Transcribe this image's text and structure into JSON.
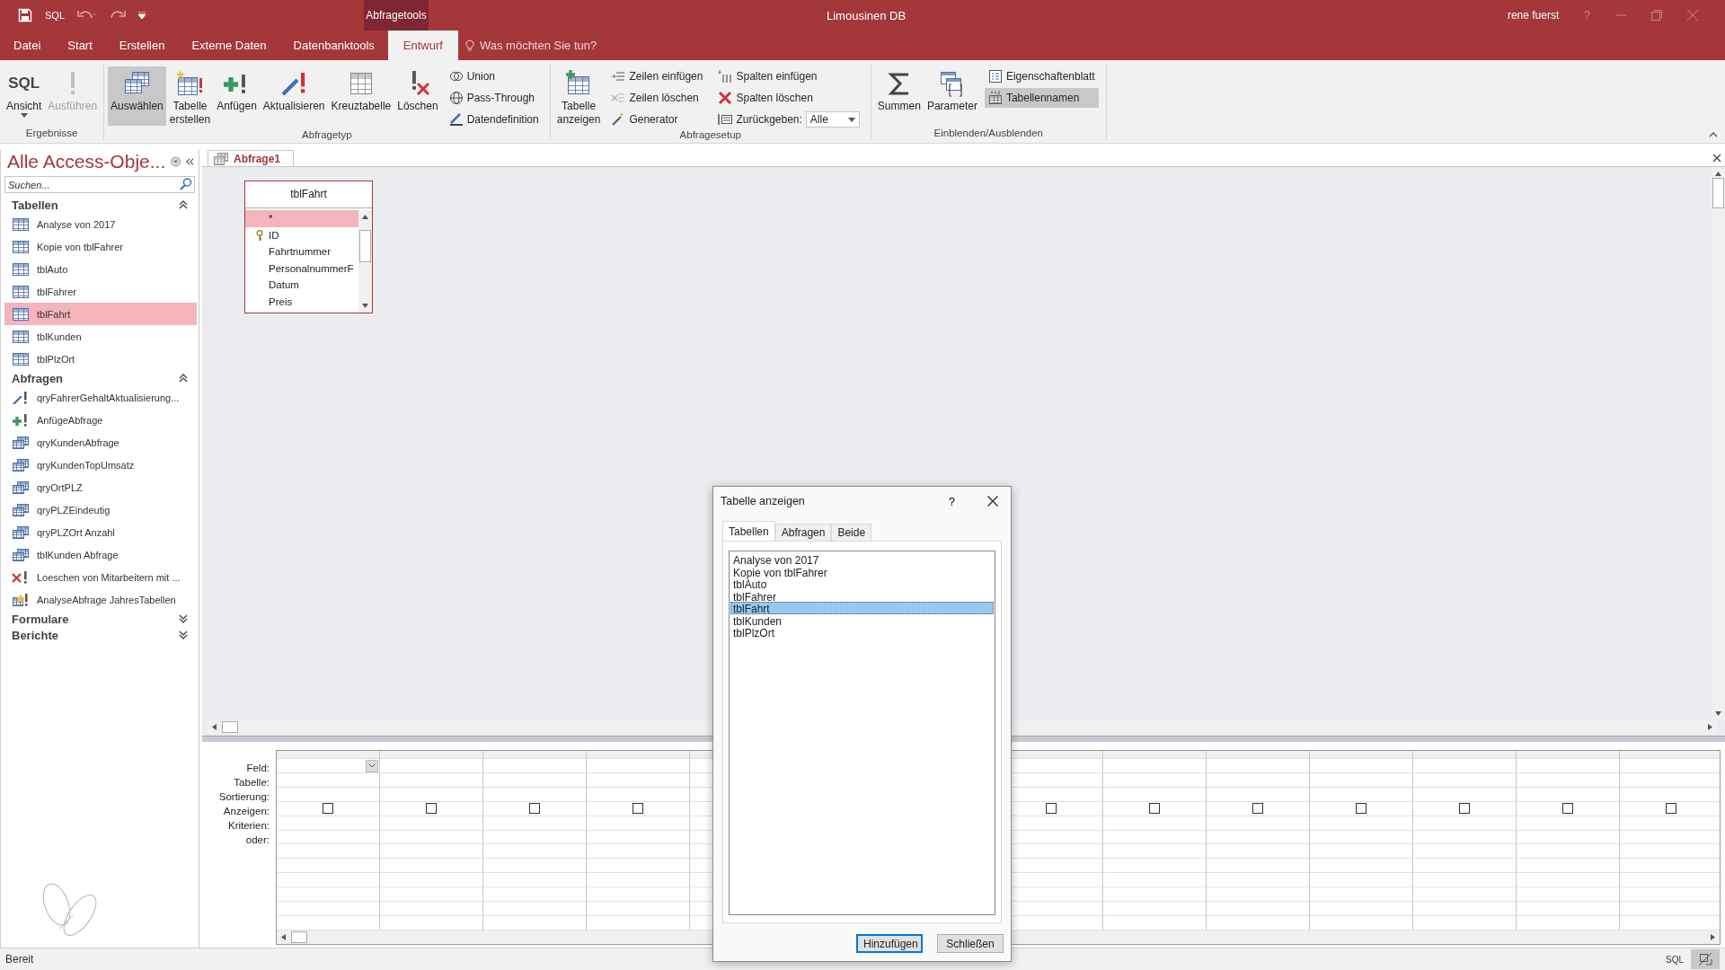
{
  "title_bar": {
    "quick_access_label": "SQL",
    "context_label": "Abfragetools",
    "title": "Limousinen DB",
    "user": "rene fuerst",
    "help": "?"
  },
  "menu_tabs": [
    {
      "label": "Datei",
      "selected": false
    },
    {
      "label": "Start",
      "selected": false
    },
    {
      "label": "Erstellen",
      "selected": false
    },
    {
      "label": "Externe Daten",
      "selected": false
    },
    {
      "label": "Datenbanktools",
      "selected": false
    },
    {
      "label": "Entwurf",
      "selected": true
    }
  ],
  "tell_me": {
    "placeholder": "Was möchten Sie tun?"
  },
  "ribbon": {
    "groups": [
      {
        "label": "Ergebnisse",
        "items": [
          {
            "kind": "large",
            "icon_text": "SQL",
            "label": "Ansicht",
            "dropdown": true,
            "selected": false,
            "disabled": false
          },
          {
            "kind": "large",
            "label": "Ausführen",
            "dropdown": false,
            "selected": false,
            "disabled": true
          }
        ]
      },
      {
        "label": "Abfragetyp",
        "items": [
          {
            "kind": "large",
            "label": "Auswählen",
            "dropdown": false,
            "selected": true,
            "disabled": false
          },
          {
            "kind": "large",
            "label": "Tabelle erstellen",
            "dropdown": false,
            "selected": false,
            "disabled": false
          },
          {
            "kind": "large",
            "label": "Anfügen",
            "dropdown": false,
            "selected": false,
            "disabled": false
          },
          {
            "kind": "large",
            "label": "Aktualisieren",
            "dropdown": false,
            "selected": false,
            "disabled": false
          },
          {
            "kind": "large",
            "label": "Kreuztabelle",
            "dropdown": false,
            "selected": false,
            "disabled": false
          },
          {
            "kind": "large",
            "label": "Löschen",
            "dropdown": false,
            "selected": false,
            "disabled": false
          },
          {
            "kind": "stack",
            "items": [
              {
                "kind": "small",
                "label": "Union",
                "selected": false,
                "disabled": false
              },
              {
                "kind": "small",
                "label": "Pass-Through",
                "selected": false,
                "disabled": false
              },
              {
                "kind": "small",
                "label": "Datendefinition",
                "selected": false,
                "disabled": false
              }
            ]
          }
        ]
      },
      {
        "label": "Abfragesetup",
        "items": [
          {
            "kind": "large",
            "label": "Tabelle anzeigen",
            "dropdown": false,
            "selected": false,
            "disabled": false
          },
          {
            "kind": "stack",
            "items": [
              {
                "kind": "small",
                "label": "Zeilen einfügen",
                "selected": false,
                "disabled": false
              },
              {
                "kind": "small",
                "label": "Zeilen löschen",
                "selected": false,
                "disabled": true
              },
              {
                "kind": "small",
                "label": "Generator",
                "selected": false,
                "disabled": false
              }
            ]
          },
          {
            "kind": "stack",
            "items": [
              {
                "kind": "small",
                "label": "Spalten einfügen",
                "selected": false,
                "disabled": false
              },
              {
                "kind": "small",
                "label": "Spalten löschen",
                "selected": false,
                "disabled": false
              },
              {
                "kind": "select",
                "label": "Zurückgeben:",
                "value": "Alle"
              }
            ]
          }
        ]
      },
      {
        "label": "Einblenden/Ausblenden",
        "items": [
          {
            "kind": "large",
            "label": "Summen",
            "dropdown": false,
            "selected": false,
            "disabled": false
          },
          {
            "kind": "large",
            "label": "Parameter",
            "dropdown": false,
            "selected": false,
            "disabled": false
          },
          {
            "kind": "stack",
            "items": [
              {
                "kind": "small",
                "label": "Eigenschaftenblatt",
                "selected": false,
                "disabled": false
              },
              {
                "kind": "small",
                "label": "Tabellennamen",
                "selected": true,
                "disabled": false
              }
            ]
          }
        ]
      }
    ]
  },
  "navigation": {
    "title": "Alle Access-Obje...",
    "search": {
      "placeholder": "Suchen..."
    },
    "groups": [
      {
        "label": "Tabellen",
        "expanded": true,
        "items": [
          {
            "kind": "table",
            "label": "Analyse von 2017",
            "selected": false
          },
          {
            "kind": "table",
            "label": "Kopie von tblFahrer",
            "selected": false
          },
          {
            "kind": "table",
            "label": "tblAuto",
            "selected": false
          },
          {
            "kind": "table",
            "label": "tblFahrer",
            "selected": false
          },
          {
            "kind": "table",
            "label": "tblFahrt",
            "selected": true
          },
          {
            "kind": "table",
            "label": "tblKunden",
            "selected": false
          },
          {
            "kind": "table",
            "label": "tblPlzOrt",
            "selected": false
          }
        ]
      },
      {
        "label": "Abfragen",
        "expanded": true,
        "items": [
          {
            "kind": "update",
            "label": "qryFahrerGehaltAktualisierung...",
            "selected": false
          },
          {
            "kind": "append",
            "label": "AnfügeAbfrage",
            "selected": false
          },
          {
            "kind": "select",
            "label": "qryKundenAbfrage",
            "selected": false
          },
          {
            "kind": "select",
            "label": "qryKundenTopUmsatz",
            "selected": false
          },
          {
            "kind": "select",
            "label": "qryOrtPLZ",
            "selected": false
          },
          {
            "kind": "select",
            "label": "qryPLZEindeutig",
            "selected": false
          },
          {
            "kind": "select",
            "label": "qryPLZOrt Anzahl",
            "selected": false
          },
          {
            "kind": "select",
            "label": "tblKunden Abfrage",
            "selected": false
          },
          {
            "kind": "delete",
            "label": "Loeschen von Mitarbeitern mit ...",
            "selected": false
          },
          {
            "kind": "make_table",
            "label": "AnalyseAbfrage JahresTabellen",
            "selected": false
          }
        ]
      },
      {
        "label": "Formulare",
        "expanded": false
      },
      {
        "label": "Berichte",
        "expanded": false
      }
    ]
  },
  "document_tabs": [
    {
      "label": "Abfrage1",
      "selected": true
    }
  ],
  "field_lists": [
    {
      "title": "tblFahrt",
      "fields": [
        {
          "label": "*",
          "key": false,
          "selected": true
        },
        {
          "label": "ID",
          "key": true,
          "selected": false
        },
        {
          "label": "Fahrtnummer",
          "key": false,
          "selected": false
        },
        {
          "label": "PersonalnummerF",
          "key": false,
          "selected": false
        },
        {
          "label": "Datum",
          "key": false,
          "selected": false
        },
        {
          "label": "Preis",
          "key": false,
          "selected": false
        }
      ]
    }
  ],
  "grid": {
    "row_labels": [
      "Feld:",
      "Tabelle:",
      "Sortierung:",
      "Anzeigen:",
      "Kriterien:",
      "oder:"
    ],
    "columns_left": [
      {
        "show": false,
        "active": true
      },
      {
        "show": false,
        "active": false
      },
      {
        "show": false,
        "active": false
      },
      {
        "show": false,
        "active": false
      }
    ],
    "columns_right": [
      {
        "show": false,
        "active": false
      },
      {
        "show": false,
        "active": false
      },
      {
        "show": false,
        "active": false
      },
      {
        "show": false,
        "active": false
      },
      {
        "show": false,
        "active": false
      },
      {
        "show": false,
        "active": false
      },
      {
        "show": false,
        "active": false
      }
    ]
  },
  "dialog": {
    "title": "Tabelle anzeigen",
    "help": "?",
    "tabs": [
      {
        "label": "Tabellen",
        "selected": true
      },
      {
        "label": "Abfragen",
        "selected": false
      },
      {
        "label": "Beide",
        "selected": false
      }
    ],
    "items": [
      {
        "label": "Analyse von 2017",
        "selected": false
      },
      {
        "label": "Kopie von tblFahrer",
        "selected": false
      },
      {
        "label": "tblAuto",
        "selected": false
      },
      {
        "label": "tblFahrer",
        "selected": false
      },
      {
        "label": "tblFahrt",
        "selected": true
      },
      {
        "label": "tblKunden",
        "selected": false
      },
      {
        "label": "tblPlzOrt",
        "selected": false
      }
    ],
    "buttons": [
      {
        "label": "Hinzufügen",
        "default": true
      },
      {
        "label": "Schließen",
        "default": false
      }
    ]
  },
  "status_bar": {
    "text": "Bereit",
    "views": [
      {
        "kind": "sql",
        "label": "SQL",
        "selected": false
      },
      {
        "kind": "design",
        "selected": true
      }
    ]
  }
}
